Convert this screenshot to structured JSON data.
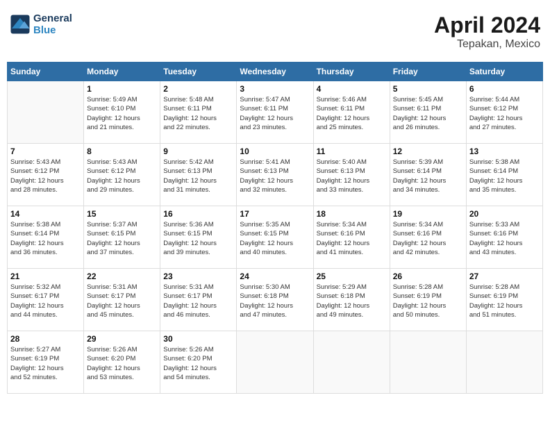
{
  "header": {
    "logo_line1": "General",
    "logo_line2": "Blue",
    "month_year": "April 2024",
    "location": "Tepakan, Mexico"
  },
  "weekdays": [
    "Sunday",
    "Monday",
    "Tuesday",
    "Wednesday",
    "Thursday",
    "Friday",
    "Saturday"
  ],
  "weeks": [
    [
      {
        "day": "",
        "info": ""
      },
      {
        "day": "1",
        "info": "Sunrise: 5:49 AM\nSunset: 6:10 PM\nDaylight: 12 hours\nand 21 minutes."
      },
      {
        "day": "2",
        "info": "Sunrise: 5:48 AM\nSunset: 6:11 PM\nDaylight: 12 hours\nand 22 minutes."
      },
      {
        "day": "3",
        "info": "Sunrise: 5:47 AM\nSunset: 6:11 PM\nDaylight: 12 hours\nand 23 minutes."
      },
      {
        "day": "4",
        "info": "Sunrise: 5:46 AM\nSunset: 6:11 PM\nDaylight: 12 hours\nand 25 minutes."
      },
      {
        "day": "5",
        "info": "Sunrise: 5:45 AM\nSunset: 6:11 PM\nDaylight: 12 hours\nand 26 minutes."
      },
      {
        "day": "6",
        "info": "Sunrise: 5:44 AM\nSunset: 6:12 PM\nDaylight: 12 hours\nand 27 minutes."
      }
    ],
    [
      {
        "day": "7",
        "info": "Sunrise: 5:43 AM\nSunset: 6:12 PM\nDaylight: 12 hours\nand 28 minutes."
      },
      {
        "day": "8",
        "info": "Sunrise: 5:43 AM\nSunset: 6:12 PM\nDaylight: 12 hours\nand 29 minutes."
      },
      {
        "day": "9",
        "info": "Sunrise: 5:42 AM\nSunset: 6:13 PM\nDaylight: 12 hours\nand 31 minutes."
      },
      {
        "day": "10",
        "info": "Sunrise: 5:41 AM\nSunset: 6:13 PM\nDaylight: 12 hours\nand 32 minutes."
      },
      {
        "day": "11",
        "info": "Sunrise: 5:40 AM\nSunset: 6:13 PM\nDaylight: 12 hours\nand 33 minutes."
      },
      {
        "day": "12",
        "info": "Sunrise: 5:39 AM\nSunset: 6:14 PM\nDaylight: 12 hours\nand 34 minutes."
      },
      {
        "day": "13",
        "info": "Sunrise: 5:38 AM\nSunset: 6:14 PM\nDaylight: 12 hours\nand 35 minutes."
      }
    ],
    [
      {
        "day": "14",
        "info": "Sunrise: 5:38 AM\nSunset: 6:14 PM\nDaylight: 12 hours\nand 36 minutes."
      },
      {
        "day": "15",
        "info": "Sunrise: 5:37 AM\nSunset: 6:15 PM\nDaylight: 12 hours\nand 37 minutes."
      },
      {
        "day": "16",
        "info": "Sunrise: 5:36 AM\nSunset: 6:15 PM\nDaylight: 12 hours\nand 39 minutes."
      },
      {
        "day": "17",
        "info": "Sunrise: 5:35 AM\nSunset: 6:15 PM\nDaylight: 12 hours\nand 40 minutes."
      },
      {
        "day": "18",
        "info": "Sunrise: 5:34 AM\nSunset: 6:16 PM\nDaylight: 12 hours\nand 41 minutes."
      },
      {
        "day": "19",
        "info": "Sunrise: 5:34 AM\nSunset: 6:16 PM\nDaylight: 12 hours\nand 42 minutes."
      },
      {
        "day": "20",
        "info": "Sunrise: 5:33 AM\nSunset: 6:16 PM\nDaylight: 12 hours\nand 43 minutes."
      }
    ],
    [
      {
        "day": "21",
        "info": "Sunrise: 5:32 AM\nSunset: 6:17 PM\nDaylight: 12 hours\nand 44 minutes."
      },
      {
        "day": "22",
        "info": "Sunrise: 5:31 AM\nSunset: 6:17 PM\nDaylight: 12 hours\nand 45 minutes."
      },
      {
        "day": "23",
        "info": "Sunrise: 5:31 AM\nSunset: 6:17 PM\nDaylight: 12 hours\nand 46 minutes."
      },
      {
        "day": "24",
        "info": "Sunrise: 5:30 AM\nSunset: 6:18 PM\nDaylight: 12 hours\nand 47 minutes."
      },
      {
        "day": "25",
        "info": "Sunrise: 5:29 AM\nSunset: 6:18 PM\nDaylight: 12 hours\nand 49 minutes."
      },
      {
        "day": "26",
        "info": "Sunrise: 5:28 AM\nSunset: 6:19 PM\nDaylight: 12 hours\nand 50 minutes."
      },
      {
        "day": "27",
        "info": "Sunrise: 5:28 AM\nSunset: 6:19 PM\nDaylight: 12 hours\nand 51 minutes."
      }
    ],
    [
      {
        "day": "28",
        "info": "Sunrise: 5:27 AM\nSunset: 6:19 PM\nDaylight: 12 hours\nand 52 minutes."
      },
      {
        "day": "29",
        "info": "Sunrise: 5:26 AM\nSunset: 6:20 PM\nDaylight: 12 hours\nand 53 minutes."
      },
      {
        "day": "30",
        "info": "Sunrise: 5:26 AM\nSunset: 6:20 PM\nDaylight: 12 hours\nand 54 minutes."
      },
      {
        "day": "",
        "info": ""
      },
      {
        "day": "",
        "info": ""
      },
      {
        "day": "",
        "info": ""
      },
      {
        "day": "",
        "info": ""
      }
    ]
  ]
}
